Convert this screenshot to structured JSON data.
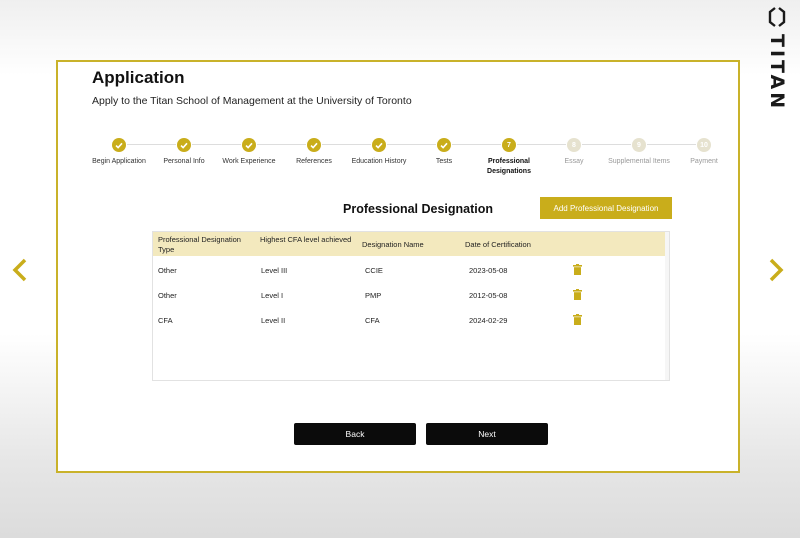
{
  "brand": {
    "name": "TITAN",
    "logo_icon": "hexagon-outline-logo"
  },
  "application": {
    "title": "Application",
    "subtitle": "Apply to the Titan School of Management at the University of Toronto"
  },
  "steps": [
    {
      "label": "Begin Application",
      "state": "done"
    },
    {
      "label": "Personal Info",
      "state": "done"
    },
    {
      "label": "Work Experience",
      "state": "done"
    },
    {
      "label": "References",
      "state": "done"
    },
    {
      "label": "Education History",
      "state": "done"
    },
    {
      "label": "Tests",
      "state": "done"
    },
    {
      "label": "Professional Designations",
      "state": "active",
      "number": "7"
    },
    {
      "label": "Essay",
      "state": "pending",
      "number": "8"
    },
    {
      "label": "Supplemental Items",
      "state": "pending",
      "number": "9"
    },
    {
      "label": "Payment",
      "state": "pending",
      "number": "10"
    }
  ],
  "section": {
    "title": "Professional Designation",
    "add_label": "Add Professional Designation"
  },
  "table": {
    "headers": [
      "Professional Designation Type",
      "Highest CFA level achieved",
      "Designation Name",
      "Date of Certification"
    ],
    "rows": [
      [
        "Other",
        "Level III",
        "CCIE",
        "2023-05-08"
      ],
      [
        "Other",
        "Level I",
        "PMP",
        "2012-05-08"
      ],
      [
        "CFA",
        "Level II",
        "CFA",
        "2024-02-29"
      ]
    ]
  },
  "footer": {
    "back_label": "Back",
    "next_label": "Next"
  },
  "colors": {
    "accent": "#c9ad1b",
    "border": "#c9b22a",
    "header_bg": "#f3e9be",
    "button_dark": "#0b0b0b",
    "pending_step": "#e6e2cf"
  }
}
